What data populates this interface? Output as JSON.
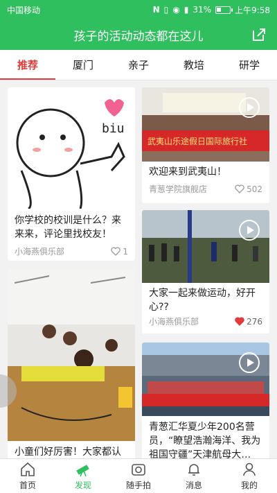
{
  "status": {
    "carrier": "中国移动",
    "battery": "31%",
    "time": "上午9:58",
    "battery_level": 0.31
  },
  "header": {
    "title": "孩子的活动动态都在这儿"
  },
  "tabs": [
    {
      "label": "推荐"
    },
    {
      "label": "厦门"
    },
    {
      "label": "亲子"
    },
    {
      "label": "教培"
    },
    {
      "label": "研学"
    }
  ],
  "posts": [
    {
      "title": "你学校的校训是什么？来来来，评论里找校友！",
      "author": "小海燕俱乐部",
      "likes": "1",
      "liked": false,
      "image_text": "biu"
    },
    {
      "title": "欢迎来到武夷山！",
      "author": "青葱学院旗舰店",
      "likes": "502",
      "liked": false,
      "banner": "武夷山乐途假日国际旅行社"
    },
    {
      "title": "大家一起来做运动，好开心??",
      "author": "小海燕俱乐部",
      "likes": "276",
      "liked": true
    },
    {
      "title": "小童们好厉害！大家都认",
      "author": "",
      "likes": "",
      "liked": false
    },
    {
      "title": "青葱汇华夏少年200名营员，“瞭望浩瀚海洋、我为祖国守疆”天津航母大…",
      "author": "",
      "likes": "",
      "liked": false
    }
  ],
  "nav": [
    {
      "label": "首页",
      "icon": "home-icon"
    },
    {
      "label": "发现",
      "icon": "telescope-icon"
    },
    {
      "label": "随手拍",
      "icon": "camera-icon"
    },
    {
      "label": "消息",
      "icon": "bell-icon"
    },
    {
      "label": "我的",
      "icon": "user-icon"
    }
  ],
  "colors": {
    "brand": "#2fbf5e",
    "accent": "#e23b3b"
  }
}
